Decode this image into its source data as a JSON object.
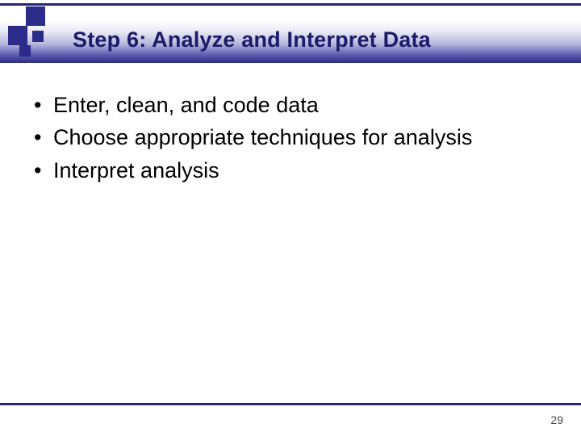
{
  "slide": {
    "title": "Step 6: Analyze and Interpret Data",
    "bullets": [
      "Enter, clean, and code data",
      "Choose appropriate techniques for analysis",
      "Interpret analysis"
    ],
    "page_number": "29"
  }
}
